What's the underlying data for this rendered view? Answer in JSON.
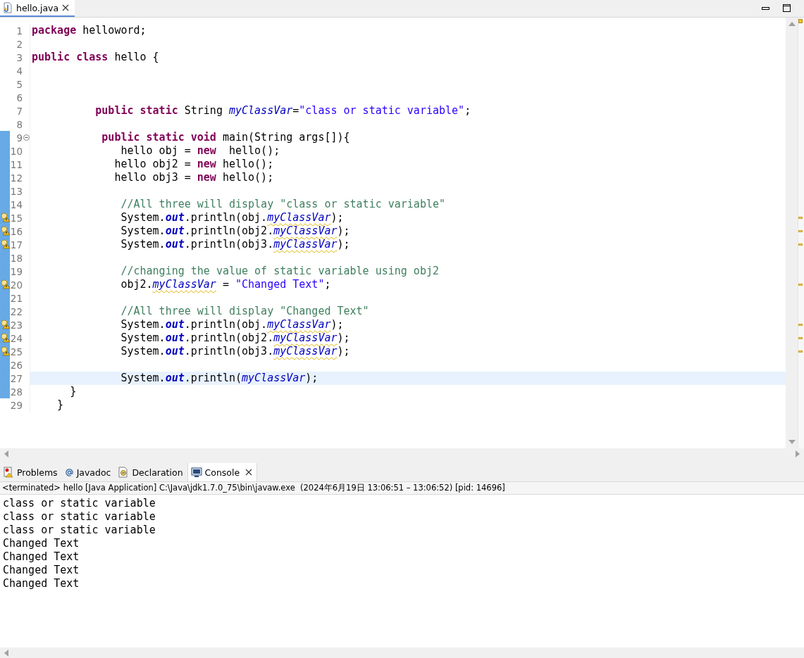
{
  "editor": {
    "tab": {
      "label": "hello.java",
      "selected": true
    },
    "lines": [
      {
        "number": "1",
        "changed": false,
        "warning": false,
        "current": false,
        "foldable": false,
        "tokens": [
          {
            "kind": "keyword",
            "text": "package"
          },
          {
            "kind": "plain",
            "text": " helloword;"
          }
        ]
      },
      {
        "number": "2",
        "changed": false,
        "warning": false,
        "current": false,
        "foldable": false
      },
      {
        "number": "3",
        "changed": false,
        "warning": false,
        "current": false,
        "foldable": false,
        "tokens": [
          {
            "kind": "keyword",
            "text": "public class"
          },
          {
            "kind": "plain",
            "text": " hello {"
          }
        ]
      },
      {
        "number": "4",
        "changed": false,
        "warning": false,
        "current": false,
        "foldable": false
      },
      {
        "number": "5",
        "changed": false,
        "warning": false,
        "current": false,
        "foldable": false
      },
      {
        "number": "6",
        "changed": false,
        "warning": false,
        "current": false,
        "foldable": false
      },
      {
        "number": "7",
        "changed": false,
        "warning": false,
        "current": false,
        "foldable": false,
        "tokens": [
          {
            "kind": "keyword",
            "text": "          public static"
          },
          {
            "kind": "plain",
            "text": " String "
          },
          {
            "kind": "field",
            "text": "myClassVar"
          },
          {
            "kind": "plain",
            "text": "="
          },
          {
            "kind": "string",
            "text": "\"class or static variable\""
          },
          {
            "kind": "plain",
            "text": ";"
          }
        ]
      },
      {
        "number": "8",
        "changed": false,
        "warning": false,
        "current": false,
        "foldable": false
      },
      {
        "number": "9",
        "changed": true,
        "warning": false,
        "current": false,
        "foldable": true,
        "tokens": [
          {
            "kind": "keyword",
            "text": "           public static void"
          },
          {
            "kind": "plain",
            "text": " main(String args[]){"
          }
        ]
      },
      {
        "number": "10",
        "changed": true,
        "warning": false,
        "current": false,
        "foldable": false,
        "tokens": [
          {
            "kind": "plain",
            "text": "              hello obj = "
          },
          {
            "kind": "keyword",
            "text": "new"
          },
          {
            "kind": "plain",
            "text": "  hello();"
          }
        ]
      },
      {
        "number": "11",
        "changed": true,
        "warning": false,
        "current": false,
        "foldable": false,
        "tokens": [
          {
            "kind": "plain",
            "text": "             hello obj2 = "
          },
          {
            "kind": "keyword",
            "text": "new"
          },
          {
            "kind": "plain",
            "text": " hello();"
          }
        ]
      },
      {
        "number": "12",
        "changed": true,
        "warning": false,
        "current": false,
        "foldable": false,
        "tokens": [
          {
            "kind": "plain",
            "text": "             hello obj3 = "
          },
          {
            "kind": "keyword",
            "text": "new"
          },
          {
            "kind": "plain",
            "text": " hello();"
          }
        ]
      },
      {
        "number": "13",
        "changed": true,
        "warning": false,
        "current": false,
        "foldable": false
      },
      {
        "number": "14",
        "changed": true,
        "warning": false,
        "current": false,
        "foldable": false,
        "tokens": [
          {
            "kind": "comment",
            "text": "              //All three will display \"class or static variable\""
          }
        ]
      },
      {
        "number": "15",
        "changed": true,
        "warning": true,
        "current": false,
        "foldable": false,
        "tokens": [
          {
            "kind": "plain",
            "text": "              System."
          },
          {
            "kind": "static",
            "text": "out"
          },
          {
            "kind": "plain",
            "text": ".println(obj."
          },
          {
            "kind": "flagged",
            "text": "myClassVar"
          },
          {
            "kind": "plain",
            "text": ");"
          }
        ]
      },
      {
        "number": "16",
        "changed": true,
        "warning": true,
        "current": false,
        "foldable": false,
        "tokens": [
          {
            "kind": "plain",
            "text": "              System."
          },
          {
            "kind": "static",
            "text": "out"
          },
          {
            "kind": "plain",
            "text": ".println(obj2."
          },
          {
            "kind": "flagged",
            "text": "myClassVar"
          },
          {
            "kind": "plain",
            "text": ");"
          }
        ]
      },
      {
        "number": "17",
        "changed": true,
        "warning": true,
        "current": false,
        "foldable": false,
        "tokens": [
          {
            "kind": "plain",
            "text": "              System."
          },
          {
            "kind": "static",
            "text": "out"
          },
          {
            "kind": "plain",
            "text": ".println(obj3."
          },
          {
            "kind": "flagged",
            "text": "myClassVar"
          },
          {
            "kind": "plain",
            "text": ");"
          }
        ]
      },
      {
        "number": "18",
        "changed": true,
        "warning": false,
        "current": false,
        "foldable": false
      },
      {
        "number": "19",
        "changed": true,
        "warning": false,
        "current": false,
        "foldable": false,
        "tokens": [
          {
            "kind": "comment",
            "text": "              //changing the value of static variable using obj2"
          }
        ]
      },
      {
        "number": "20",
        "changed": true,
        "warning": true,
        "current": false,
        "foldable": false,
        "tokens": [
          {
            "kind": "plain",
            "text": "              obj2."
          },
          {
            "kind": "flagged",
            "text": "myClassVar"
          },
          {
            "kind": "plain",
            "text": " = "
          },
          {
            "kind": "string",
            "text": "\"Changed Text\""
          },
          {
            "kind": "plain",
            "text": ";"
          }
        ]
      },
      {
        "number": "21",
        "changed": true,
        "warning": false,
        "current": false,
        "foldable": false
      },
      {
        "number": "22",
        "changed": true,
        "warning": false,
        "current": false,
        "foldable": false,
        "tokens": [
          {
            "kind": "comment",
            "text": "              //All three will display \"Changed Text\""
          }
        ]
      },
      {
        "number": "23",
        "changed": true,
        "warning": true,
        "current": false,
        "foldable": false,
        "tokens": [
          {
            "kind": "plain",
            "text": "              System."
          },
          {
            "kind": "static",
            "text": "out"
          },
          {
            "kind": "plain",
            "text": ".println(obj."
          },
          {
            "kind": "flagged",
            "text": "myClassVar"
          },
          {
            "kind": "plain",
            "text": ");"
          }
        ]
      },
      {
        "number": "24",
        "changed": true,
        "warning": true,
        "current": false,
        "foldable": false,
        "tokens": [
          {
            "kind": "plain",
            "text": "              System."
          },
          {
            "kind": "static",
            "text": "out"
          },
          {
            "kind": "plain",
            "text": ".println(obj2."
          },
          {
            "kind": "flagged",
            "text": "myClassVar"
          },
          {
            "kind": "plain",
            "text": ");"
          }
        ]
      },
      {
        "number": "25",
        "changed": true,
        "warning": true,
        "current": false,
        "foldable": false,
        "tokens": [
          {
            "kind": "plain",
            "text": "              System."
          },
          {
            "kind": "static",
            "text": "out"
          },
          {
            "kind": "plain",
            "text": ".println(obj3."
          },
          {
            "kind": "flagged",
            "text": "myClassVar"
          },
          {
            "kind": "plain",
            "text": ");"
          }
        ]
      },
      {
        "number": "26",
        "changed": true,
        "warning": false,
        "current": false,
        "foldable": false
      },
      {
        "number": "27",
        "changed": true,
        "warning": false,
        "current": true,
        "foldable": false,
        "tokens": [
          {
            "kind": "plain",
            "text": "              System."
          },
          {
            "kind": "static",
            "text": "out"
          },
          {
            "kind": "plain",
            "text": ".println("
          },
          {
            "kind": "field",
            "text": "myClassVar"
          },
          {
            "kind": "plain",
            "text": ");"
          }
        ]
      },
      {
        "number": "28",
        "changed": true,
        "warning": false,
        "current": false,
        "foldable": false,
        "tokens": [
          {
            "kind": "plain",
            "text": "      }"
          }
        ]
      },
      {
        "number": "29",
        "changed": false,
        "warning": false,
        "current": false,
        "foldable": false,
        "tokens": [
          {
            "kind": "plain",
            "text": "    }"
          }
        ]
      }
    ]
  },
  "bottom_panel": {
    "tabs": [
      {
        "kind": "problems",
        "label": "Problems",
        "selected": false
      },
      {
        "kind": "javadoc",
        "label": "Javadoc",
        "selected": false
      },
      {
        "kind": "declaration",
        "label": "Declaration",
        "selected": false
      },
      {
        "kind": "console",
        "label": "Console",
        "selected": true
      }
    ],
    "status": "<terminated> hello [Java Application] C:\\Java\\jdk1.7.0_75\\bin\\javaw.exe  (2024年6月19日 13:06:51 – 13:06:52) [pid: 14696]",
    "output": [
      "class or static variable",
      "class or static variable",
      "class or static variable",
      "Changed Text",
      "Changed Text",
      "Changed Text",
      "Changed Text"
    ]
  }
}
